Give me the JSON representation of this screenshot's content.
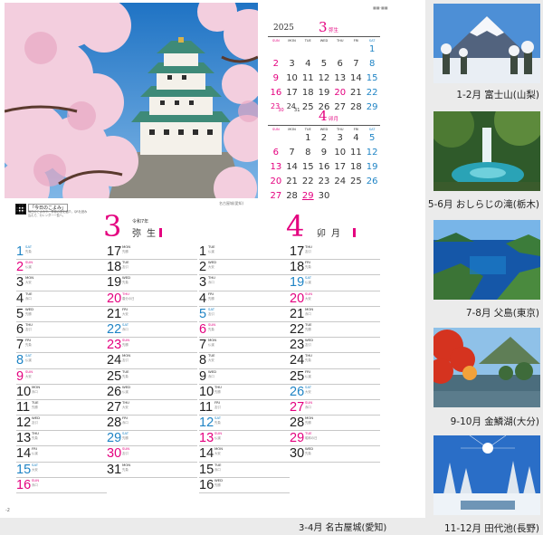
{
  "page": {
    "corner_mark": "■■-■■",
    "page_number": "-2",
    "photo_credit": "名古屋城(愛知)"
  },
  "qr": {
    "title": "「今日のこよみ」",
    "text": "毎日のこよみや、季節の暦を紹介。QRを読み込んで、カレンダー一覧へ。"
  },
  "main_caption": "3-4月 名古屋城(愛知)",
  "colors": {
    "holiday": "#e4007f",
    "saturday": "#1f84c5",
    "weekday": "#222222"
  },
  "mini_calendars": [
    {
      "year": "2025",
      "month": "3",
      "name": "弥生",
      "dow": [
        "SUN",
        "MON",
        "TUE",
        "WED",
        "THU",
        "FRI",
        "SAT"
      ],
      "cells": [
        {
          "col": 6,
          "day": "1",
          "c": "sat"
        },
        {
          "col": 0,
          "day": "2",
          "c": "sun"
        },
        {
          "col": 1,
          "day": "3"
        },
        {
          "col": 2,
          "day": "4"
        },
        {
          "col": 3,
          "day": "5"
        },
        {
          "col": 4,
          "day": "6"
        },
        {
          "col": 5,
          "day": "7"
        },
        {
          "col": 6,
          "day": "8",
          "c": "sat"
        },
        {
          "col": 0,
          "day": "9",
          "c": "sun"
        },
        {
          "col": 1,
          "day": "10"
        },
        {
          "col": 2,
          "day": "11"
        },
        {
          "col": 3,
          "day": "12"
        },
        {
          "col": 4,
          "day": "13"
        },
        {
          "col": 5,
          "day": "14"
        },
        {
          "col": 6,
          "day": "15",
          "c": "sat"
        },
        {
          "col": 0,
          "day": "16",
          "c": "sun"
        },
        {
          "col": 1,
          "day": "17"
        },
        {
          "col": 2,
          "day": "18"
        },
        {
          "col": 3,
          "day": "19"
        },
        {
          "col": 4,
          "day": "20",
          "c": "sun"
        },
        {
          "col": 5,
          "day": "21"
        },
        {
          "col": 6,
          "day": "22",
          "c": "sat"
        },
        {
          "col": 0,
          "day": "23",
          "sub": "30",
          "c": "sun"
        },
        {
          "col": 1,
          "day": "24",
          "sub": "31"
        },
        {
          "col": 2,
          "day": "25"
        },
        {
          "col": 3,
          "day": "26"
        },
        {
          "col": 4,
          "day": "27"
        },
        {
          "col": 5,
          "day": "28"
        },
        {
          "col": 6,
          "day": "29",
          "c": "sat"
        }
      ]
    },
    {
      "month": "4",
      "name": "卯月",
      "dow": [
        "SUN",
        "MON",
        "TUE",
        "WED",
        "THU",
        "FRI",
        "SAT"
      ],
      "cells": [
        {
          "col": 2,
          "day": "1"
        },
        {
          "col": 3,
          "day": "2"
        },
        {
          "col": 4,
          "day": "3"
        },
        {
          "col": 5,
          "day": "4"
        },
        {
          "col": 6,
          "day": "5",
          "c": "sat"
        },
        {
          "col": 0,
          "day": "6",
          "c": "sun"
        },
        {
          "col": 1,
          "day": "7"
        },
        {
          "col": 2,
          "day": "8"
        },
        {
          "col": 3,
          "day": "9"
        },
        {
          "col": 4,
          "day": "10"
        },
        {
          "col": 5,
          "day": "11"
        },
        {
          "col": 6,
          "day": "12",
          "c": "sat"
        },
        {
          "col": 0,
          "day": "13",
          "c": "sun"
        },
        {
          "col": 1,
          "day": "14"
        },
        {
          "col": 2,
          "day": "15"
        },
        {
          "col": 3,
          "day": "16"
        },
        {
          "col": 4,
          "day": "17"
        },
        {
          "col": 5,
          "day": "18"
        },
        {
          "col": 6,
          "day": "19",
          "c": "sat"
        },
        {
          "col": 0,
          "day": "20",
          "c": "sun"
        },
        {
          "col": 1,
          "day": "21"
        },
        {
          "col": 2,
          "day": "22"
        },
        {
          "col": 3,
          "day": "23"
        },
        {
          "col": 4,
          "day": "24"
        },
        {
          "col": 5,
          "day": "25"
        },
        {
          "col": 6,
          "day": "26",
          "c": "sat"
        },
        {
          "col": 0,
          "day": "27",
          "c": "sun"
        },
        {
          "col": 1,
          "day": "28"
        },
        {
          "col": 2,
          "day": "29",
          "c": "sun",
          "underline": true
        },
        {
          "col": 3,
          "day": "30"
        }
      ]
    }
  ],
  "big_calendars": [
    {
      "month": "3",
      "wareki": "令和7年",
      "name": "弥生",
      "columns": [
        [
          {
            "d": "1",
            "w": "SAT",
            "n": "先負",
            "c": "sat"
          },
          {
            "d": "2",
            "w": "SUN",
            "n": "仏滅",
            "c": "sun"
          },
          {
            "d": "3",
            "w": "MON",
            "n": "大安"
          },
          {
            "d": "4",
            "w": "TUE",
            "n": "赤口"
          },
          {
            "d": "5",
            "w": "WED",
            "n": "先勝"
          },
          {
            "d": "6",
            "w": "THU",
            "n": "友引"
          },
          {
            "d": "7",
            "w": "FRI",
            "n": "先負"
          },
          {
            "d": "8",
            "w": "SAT",
            "n": "仏滅",
            "c": "sat"
          },
          {
            "d": "9",
            "w": "SUN",
            "n": "大安",
            "c": "sun"
          },
          {
            "d": "10",
            "w": "MON",
            "n": "赤口"
          },
          {
            "d": "11",
            "w": "TUE",
            "n": "先勝"
          },
          {
            "d": "12",
            "w": "WED",
            "n": "友引"
          },
          {
            "d": "13",
            "w": "THU",
            "n": "先負"
          },
          {
            "d": "14",
            "w": "FRI",
            "n": "仏滅"
          },
          {
            "d": "15",
            "w": "SAT",
            "n": "大安",
            "c": "sat"
          },
          {
            "d": "16",
            "w": "SUN",
            "n": "赤口",
            "c": "sun"
          }
        ],
        [
          {
            "d": "17",
            "w": "MON",
            "n": "先勝"
          },
          {
            "d": "18",
            "w": "TUE",
            "n": "友引"
          },
          {
            "d": "19",
            "w": "WED",
            "n": "先負"
          },
          {
            "d": "20",
            "w": "THU",
            "n": "春分の日",
            "c": "sun"
          },
          {
            "d": "21",
            "w": "FRI",
            "n": "大安"
          },
          {
            "d": "22",
            "w": "SAT",
            "n": "赤口",
            "c": "sat"
          },
          {
            "d": "23",
            "w": "SUN",
            "n": "先勝",
            "c": "sun"
          },
          {
            "d": "24",
            "w": "MON",
            "n": "友引"
          },
          {
            "d": "25",
            "w": "TUE",
            "n": "先負"
          },
          {
            "d": "26",
            "w": "WED",
            "n": "仏滅"
          },
          {
            "d": "27",
            "w": "THU",
            "n": "大安"
          },
          {
            "d": "28",
            "w": "FRI",
            "n": "赤口"
          },
          {
            "d": "29",
            "w": "SAT",
            "n": "先勝",
            "c": "sat"
          },
          {
            "d": "30",
            "w": "SUN",
            "n": "友引",
            "c": "sun"
          },
          {
            "d": "31",
            "w": "MON",
            "n": "先負"
          }
        ]
      ]
    },
    {
      "month": "4",
      "name": "卯月",
      "columns": [
        [
          {
            "d": "1",
            "w": "TUE",
            "n": "仏滅"
          },
          {
            "d": "2",
            "w": "WED",
            "n": "大安"
          },
          {
            "d": "3",
            "w": "THU",
            "n": "赤口"
          },
          {
            "d": "4",
            "w": "FRI",
            "n": "先勝"
          },
          {
            "d": "5",
            "w": "SAT",
            "n": "友引",
            "c": "sat"
          },
          {
            "d": "6",
            "w": "SUN",
            "n": "先負",
            "c": "sun"
          },
          {
            "d": "7",
            "w": "MON",
            "n": "仏滅"
          },
          {
            "d": "8",
            "w": "TUE",
            "n": "大安"
          },
          {
            "d": "9",
            "w": "WED",
            "n": "赤口"
          },
          {
            "d": "10",
            "w": "THU",
            "n": "先勝"
          },
          {
            "d": "11",
            "w": "FRI",
            "n": "友引"
          },
          {
            "d": "12",
            "w": "SAT",
            "n": "先負",
            "c": "sat"
          },
          {
            "d": "13",
            "w": "SUN",
            "n": "仏滅",
            "c": "sun"
          },
          {
            "d": "14",
            "w": "MON",
            "n": "大安"
          },
          {
            "d": "15",
            "w": "TUE",
            "n": "赤口"
          },
          {
            "d": "16",
            "w": "WED",
            "n": "先勝"
          }
        ],
        [
          {
            "d": "17",
            "w": "THU",
            "n": "友引"
          },
          {
            "d": "18",
            "w": "FRI",
            "n": "先負"
          },
          {
            "d": "19",
            "w": "SAT",
            "n": "仏滅",
            "c": "sat"
          },
          {
            "d": "20",
            "w": "SUN",
            "n": "大安",
            "c": "sun"
          },
          {
            "d": "21",
            "w": "MON",
            "n": "赤口"
          },
          {
            "d": "22",
            "w": "TUE",
            "n": "先勝"
          },
          {
            "d": "23",
            "w": "WED",
            "n": "友引"
          },
          {
            "d": "24",
            "w": "THU",
            "n": "先負"
          },
          {
            "d": "25",
            "w": "FRI",
            "n": "仏滅"
          },
          {
            "d": "26",
            "w": "SAT",
            "n": "大安",
            "c": "sat"
          },
          {
            "d": "27",
            "w": "SUN",
            "n": "赤口",
            "c": "sun"
          },
          {
            "d": "28",
            "w": "MON",
            "n": "先勝"
          },
          {
            "d": "29",
            "w": "TUE",
            "n": "昭和の日",
            "c": "sun"
          },
          {
            "d": "30",
            "w": "WED",
            "n": "先負"
          }
        ]
      ]
    }
  ],
  "thumbnails": [
    {
      "caption": "1-2月 富士山(山梨)"
    },
    {
      "caption": "5-6月 おしらじの滝(栃木)"
    },
    {
      "caption": "7-8月 父島(東京)"
    },
    {
      "caption": "9-10月 金鱗湖(大分)"
    },
    {
      "caption": "11-12月 田代池(長野)"
    }
  ]
}
